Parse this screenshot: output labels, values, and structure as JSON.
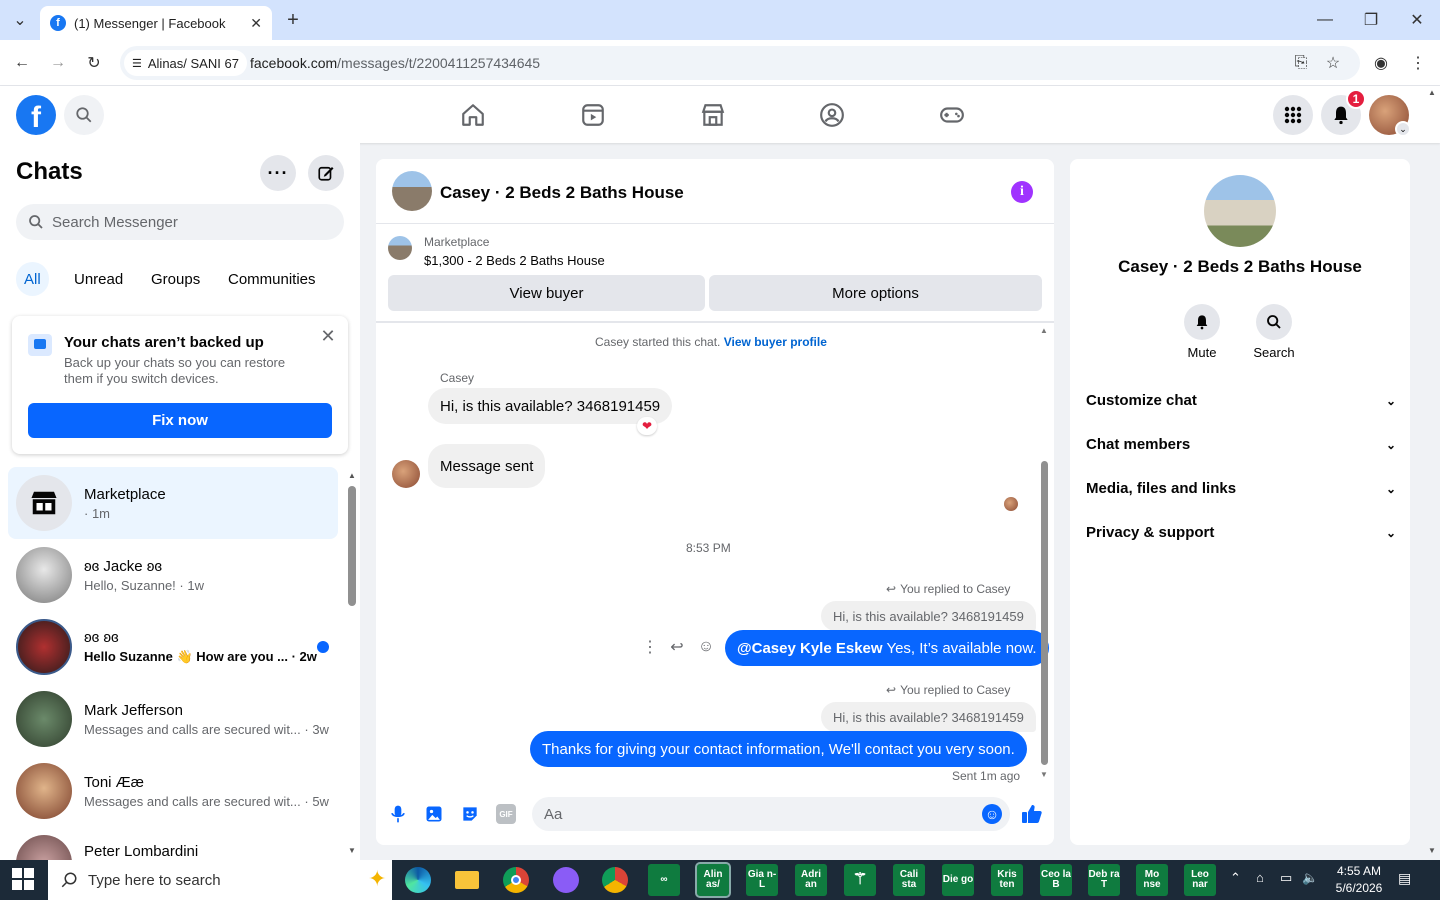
{
  "browser": {
    "tab_title": "(1) Messenger | Facebook",
    "site_chip": "Alinas/ SANI 67",
    "url_host": "facebook.com",
    "url_path": "/messages/t/2200411257434645"
  },
  "header": {
    "notification_count": "1"
  },
  "left": {
    "title": "Chats",
    "search_placeholder": "Search Messenger",
    "filters": [
      "All",
      "Unread",
      "Groups",
      "Communities"
    ],
    "backup": {
      "title": "Your chats aren’t backed up",
      "body": "Back up your chats so you can restore them if you switch devices.",
      "button": "Fix now"
    },
    "chats": [
      {
        "name": "Marketplace",
        "preview": "· 1m"
      },
      {
        "name": "ʚɞ Jacke ʚɞ",
        "preview": "Hello, Suzanne! · 1w"
      },
      {
        "name": "ʚɞ ʚɞ",
        "preview": "Hello Suzanne 👋 How are you ... · 2w"
      },
      {
        "name": "Mark Jefferson",
        "preview": "Messages and calls are secured wit... · 3w"
      },
      {
        "name": "Toni Ææ",
        "preview": "Messages and calls are secured wit... · 5w"
      },
      {
        "name": "Peter Lombardini",
        "preview": ""
      }
    ]
  },
  "conversation": {
    "title": "Casey · 2 Beds 2 Baths House",
    "listing_source": "Marketplace",
    "listing_title": "$1,300 - 2 Beds 2 Baths House",
    "view_buyer": "View buyer",
    "more_options": "More options",
    "started_text": "Casey started this chat.",
    "view_buyer_profile": "View buyer profile",
    "sender_name": "Casey",
    "msg1": "Hi, is this available? 3468191459",
    "msg2": "Message sent",
    "time_divider": "8:53 PM",
    "reply_label": "You replied to Casey",
    "quoted": "Hi, is this available? 3468191459",
    "out1_mention": "@Casey Kyle Eskew",
    "out1_text": " Yes, It’s available now.",
    "reply_label2": "You replied to Casey",
    "quoted2": "Hi, is this available? 3468191459",
    "out2": "Thanks for giving your contact information, We'll contact you very soon.",
    "sent_status": "Sent 1m ago",
    "composer_placeholder": "Aa"
  },
  "info": {
    "name": "Casey · 2 Beds 2 Baths House",
    "mute": "Mute",
    "search": "Search",
    "sections": [
      "Customize chat",
      "Chat members",
      "Media, files and links",
      "Privacy & support"
    ]
  },
  "taskbar": {
    "search_placeholder": "Type here to search",
    "apps": [
      "Alin as/",
      "Gia n-L",
      "Adri an",
      "Cali sta",
      "Die go",
      "Kris ten",
      "Ceo la B",
      "Deb ra T",
      "Mo nse",
      "Leo nar"
    ],
    "time": "4:55 AM",
    "date": "5/6/2026"
  },
  "colors": {
    "accent": "#0866ff",
    "fb_blue": "#1877f2",
    "badge_red": "#e41e3f"
  }
}
